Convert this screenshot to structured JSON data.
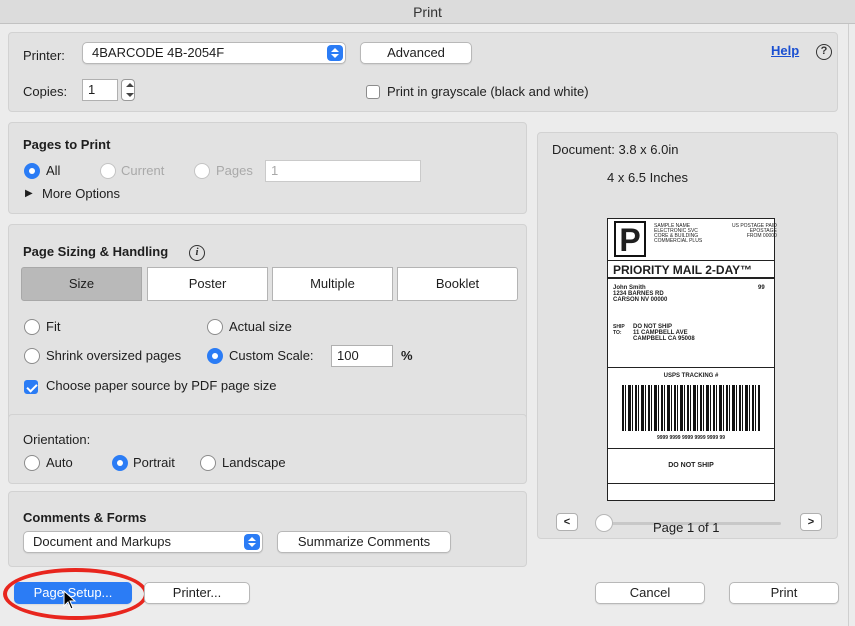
{
  "window": {
    "title": "Print"
  },
  "top": {
    "printer_label": "Printer:",
    "printer_value": "4BARCODE 4B-2054F",
    "advanced_label": "Advanced",
    "help_label": "Help",
    "copies_label": "Copies:",
    "copies_value": "1",
    "grayscale_label": "Print in grayscale (black and white)",
    "grayscale_checked": false
  },
  "pages_to_print": {
    "title": "Pages to Print",
    "all_label": "All",
    "current_label": "Current",
    "pages_label": "Pages",
    "pages_value": "1",
    "selected": "All",
    "more_options_label": "More Options"
  },
  "sizing": {
    "title": "Page Sizing & Handling",
    "tabs": [
      "Size",
      "Poster",
      "Multiple",
      "Booklet"
    ],
    "selected_tab": "Size",
    "fit_label": "Fit",
    "actual_size_label": "Actual size",
    "shrink_label": "Shrink oversized pages",
    "custom_scale_label": "Custom Scale:",
    "custom_scale_value": "100",
    "percent_label": "%",
    "selected_option": "Custom Scale",
    "paper_source_label": "Choose paper source by PDF page size",
    "paper_source_checked": true
  },
  "orientation": {
    "title": "Orientation:",
    "auto_label": "Auto",
    "portrait_label": "Portrait",
    "landscape_label": "Landscape",
    "selected": "Portrait"
  },
  "comments": {
    "title": "Comments & Forms",
    "select_value": "Document and Markups",
    "summarize_label": "Summarize Comments"
  },
  "preview": {
    "document_size": "Document: 3.8 x 6.0in",
    "paper_size": "4 x 6.5 Inches",
    "page_indicator": "Page 1 of 1",
    "prev_label": "<",
    "next_label": ">"
  },
  "shipping_label": {
    "big_letter": "P",
    "sender_block": [
      "SAMPLE NAME",
      "ELECTRONIC SVC",
      "CORE & BUILDING",
      "COMMERCIAL PLUS"
    ],
    "permit_block": [
      "US POSTAGE PAID",
      "EPOSTAGE",
      "FROM 00000"
    ],
    "service": "PRIORITY MAIL 2-DAY™",
    "from_lines": [
      "John Smith",
      "1234 BARNES RD",
      "CARSON NV 00000"
    ],
    "zone": "99",
    "ship_to_label": "SHIP TO:",
    "to_lines": [
      "DO NOT SHIP",
      "11 CAMPBELL AVE",
      "CAMPBELL CA 95008"
    ],
    "tracking_title": "USPS TRACKING #",
    "tracking_number": "9999 9999 9999 9999 9999 99",
    "footer": "DO NOT SHIP"
  },
  "bottom": {
    "page_setup_label": "Page Setup...",
    "printer_button_label": "Printer...",
    "cancel_label": "Cancel",
    "print_label": "Print"
  },
  "colors": {
    "accent": "#2b7cf5",
    "highlight_ring": "#e8261e",
    "help_link": "#1a4fd1"
  }
}
